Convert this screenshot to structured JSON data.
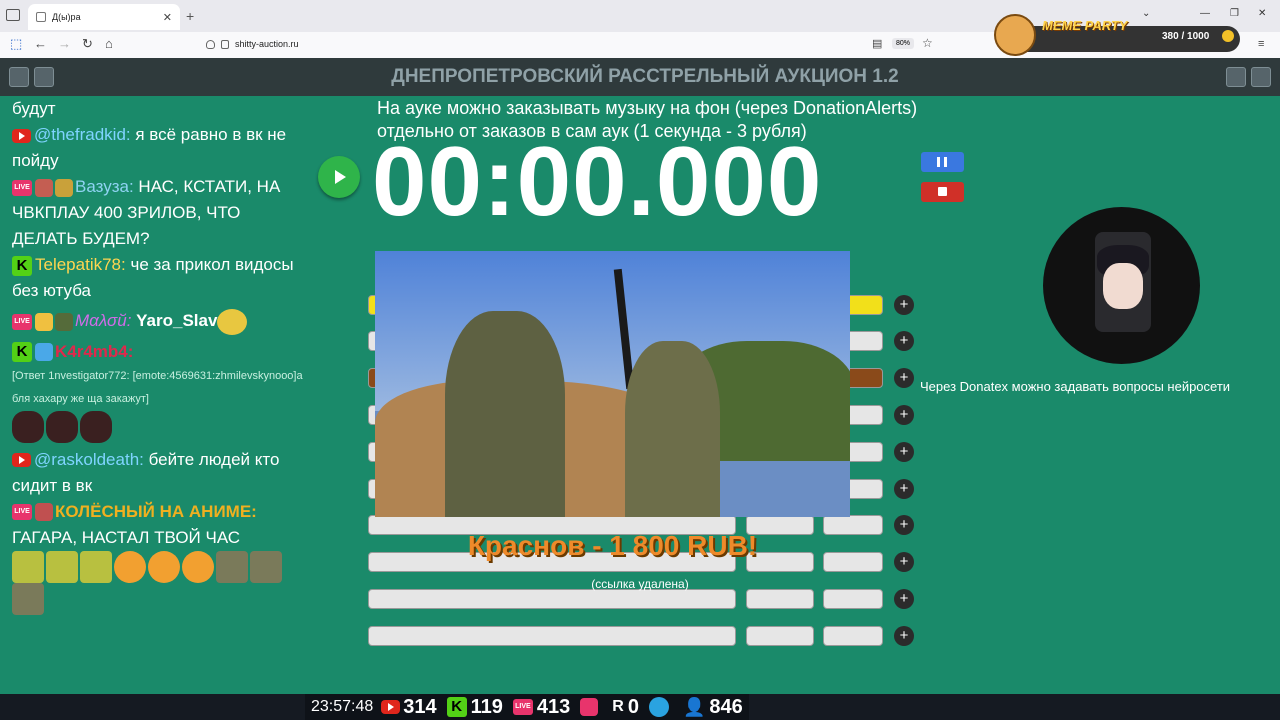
{
  "browser": {
    "tab_title": "Д(ы)ра",
    "url": "shitty-auction.ru",
    "zoom": "80%"
  },
  "meme_party": {
    "label": "MEME PARTY",
    "count": "380 / 1000"
  },
  "app": {
    "title": "ДНЕПРОПЕТРОВСКИЙ РАССТРЕЛЬНЫЙ АУКЦИОН 1.2"
  },
  "chat": [
    {
      "platform": "",
      "name": "",
      "text": "будут"
    },
    {
      "platform": "youtube",
      "name": "@thefradkid:",
      "text": " я всё равно в вк не пойду"
    },
    {
      "platform": "vk",
      "name": "Вазуза:",
      "text": " НАС, КСТАТИ, НА ЧВКПЛАУ 400 ЗРИЛОВ, ЧТО ДЕЛАТЬ БУДЕМ?"
    },
    {
      "platform": "kick",
      "name": "Telepatik78:",
      "text": " че за прикол видосы без ютуба"
    },
    {
      "platform": "vk",
      "name": "Мαλσй:",
      "text": " Yaro_Slav"
    },
    {
      "platform": "kick",
      "name": "K4r4mb4:",
      "text": ""
    },
    {
      "platform": "",
      "name": "",
      "text": "[Ответ 1nvestigator772: [emote:4569631:zhmilevskynooo]а бля хахару же ща закажут]"
    },
    {
      "platform": "youtube",
      "name": "@raskoldeath:",
      "text": " бейте людей кто сидит в вк"
    },
    {
      "platform": "vk",
      "name": "КОЛЁСНЫЙ НА АНИМЕ:",
      "text": " ГАГАРА, НАСТАЛ ТВОЙ ЧАС"
    }
  ],
  "main": {
    "info_line1": "На ауке можно заказывать музыку на фон (через DonationAlerts)",
    "info_line2": "отдельно от заказов в сам аук (1 секунда - 3 рубля)",
    "timer": "00:00.000",
    "donatex_note": "Через Donatex можно задавать вопросы нейросети",
    "donation": "Краснов - 1 800 RUB!",
    "donation_link": "(ссылка удалена)",
    "plus": "+"
  },
  "stats": {
    "time": "23:57:48",
    "youtube": "314",
    "kick": "119",
    "vk": "413",
    "rutube": "0",
    "total": "846"
  }
}
